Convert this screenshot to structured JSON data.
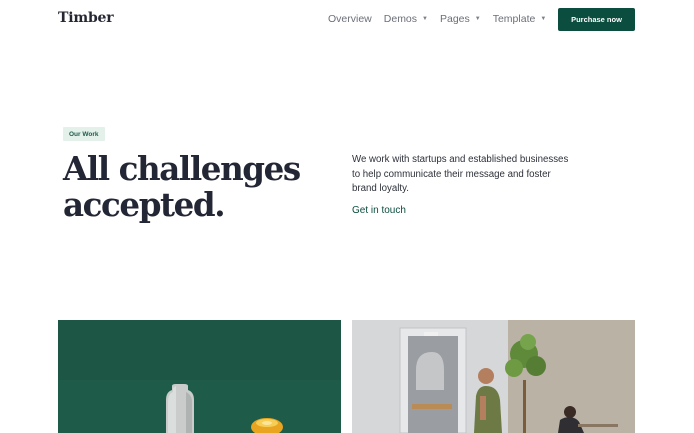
{
  "header": {
    "brand": "Timber",
    "nav": [
      {
        "label": "Overview",
        "has_dropdown": false
      },
      {
        "label": "Demos",
        "has_dropdown": true
      },
      {
        "label": "Pages",
        "has_dropdown": true
      },
      {
        "label": "Template",
        "has_dropdown": true
      }
    ],
    "purchase_label": "Purchase now"
  },
  "hero": {
    "badge": "Our Work",
    "title_line1": "All challenges",
    "title_line2": "accepted.",
    "description": "We work with startups and established businesses to help communicate their message and foster brand loyalty.",
    "cta": "Get in touch"
  },
  "colors": {
    "accent": "#0b4d3e",
    "badge_bg": "#e3f1ea",
    "card_green": "#1f5b49"
  }
}
